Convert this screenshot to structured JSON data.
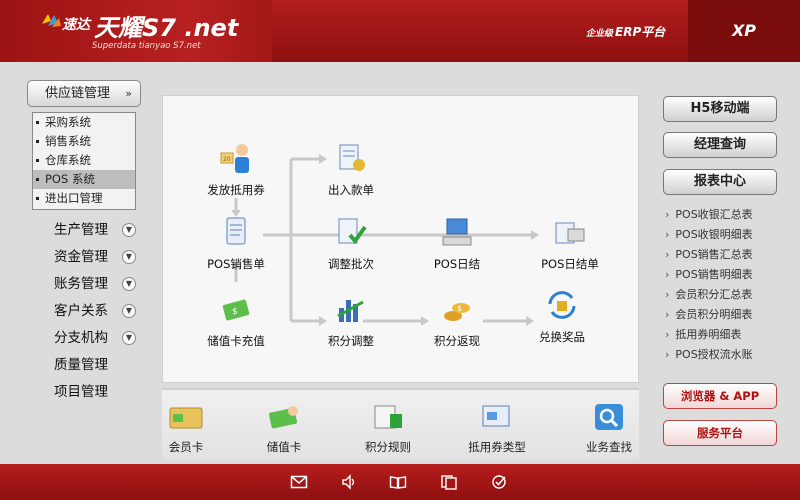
{
  "header": {
    "logo_small": "速达",
    "logo_big": "天耀S7 .net",
    "logo_sub": "Superdata tianyao S7.net",
    "erp_prefix": "企业级",
    "erp_label": "ERP平台",
    "xp_label": "XP"
  },
  "left_nav": {
    "supply_label": "供应链管理",
    "submenu": [
      "采购系统",
      "销售系统",
      "仓库系统",
      "POS 系统",
      "进出口管理"
    ],
    "submenu_active": "POS 系统",
    "items": [
      "生产管理",
      "资金管理",
      "账务管理",
      "客户关系",
      "分支机构",
      "质量管理",
      "项目管理"
    ]
  },
  "flow": {
    "nodes": {
      "issue_voucher": "发放抵用券",
      "pos_sales": "POS销售单",
      "stored_card_topup": "储值卡充值",
      "cash_in_out": "出入款单",
      "adjust_batch": "调整批次",
      "points_adjust": "积分调整",
      "pos_daily": "POS日结",
      "points_cashback": "积分返现",
      "pos_daily_statement": "POS日结单",
      "redeem_prize": "兑换奖品"
    }
  },
  "bottom": {
    "items": [
      "会员卡",
      "储值卡",
      "积分规则",
      "抵用券类型",
      "业务查找"
    ]
  },
  "right_panel": {
    "buttons": [
      "H5移动端",
      "经理查询",
      "报表中心"
    ],
    "links": [
      "POS收银汇总表",
      "POS收银明细表",
      "POS销售汇总表",
      "POS销售明细表",
      "会员积分汇总表",
      "会员积分明细表",
      "抵用券明细表",
      "POS授权流水账"
    ],
    "red_buttons": [
      "浏览器 & APP",
      "服务平台"
    ]
  },
  "colors": {
    "brand_red": "#a51515",
    "panel_bg": "#f7f7f7",
    "page_bg": "#dcdcdc"
  },
  "footer": {
    "icons": [
      "mail-icon",
      "sound-icon",
      "book-icon",
      "copy-icon",
      "check-icon"
    ]
  }
}
